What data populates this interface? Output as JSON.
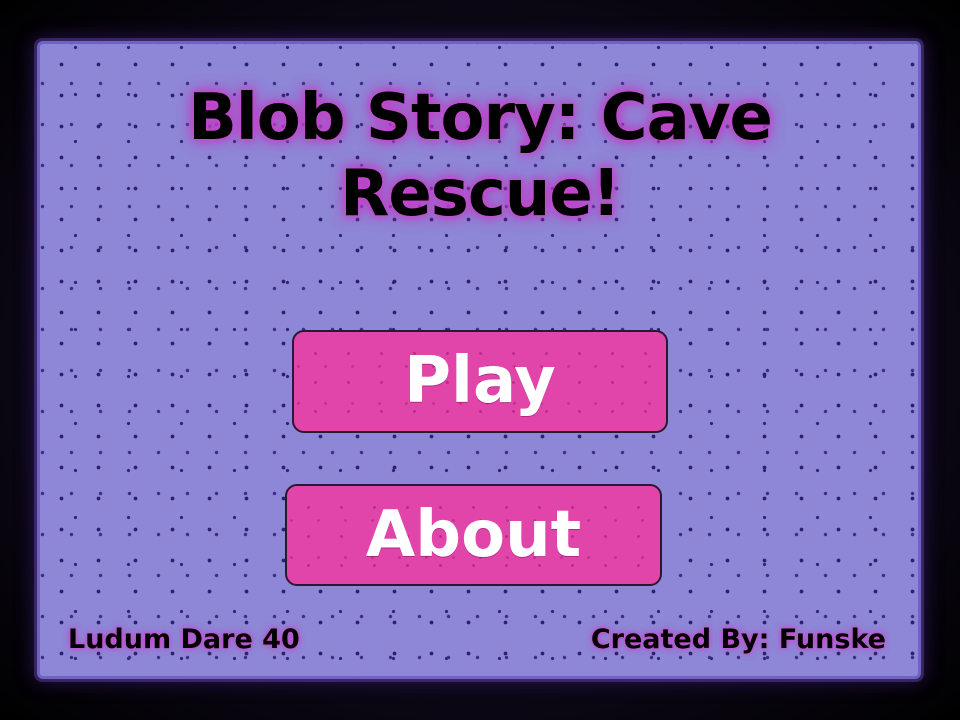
{
  "game": {
    "title": "Blob Story: Cave Rescue!"
  },
  "menu": {
    "play_label": "Play",
    "about_label": "About"
  },
  "footer": {
    "left_text": "Ludum Dare 40",
    "right_text": "Created By: Funske"
  },
  "colors": {
    "background": "#8e86d6",
    "button": "#e245aa",
    "glow": "#c23ec8"
  }
}
